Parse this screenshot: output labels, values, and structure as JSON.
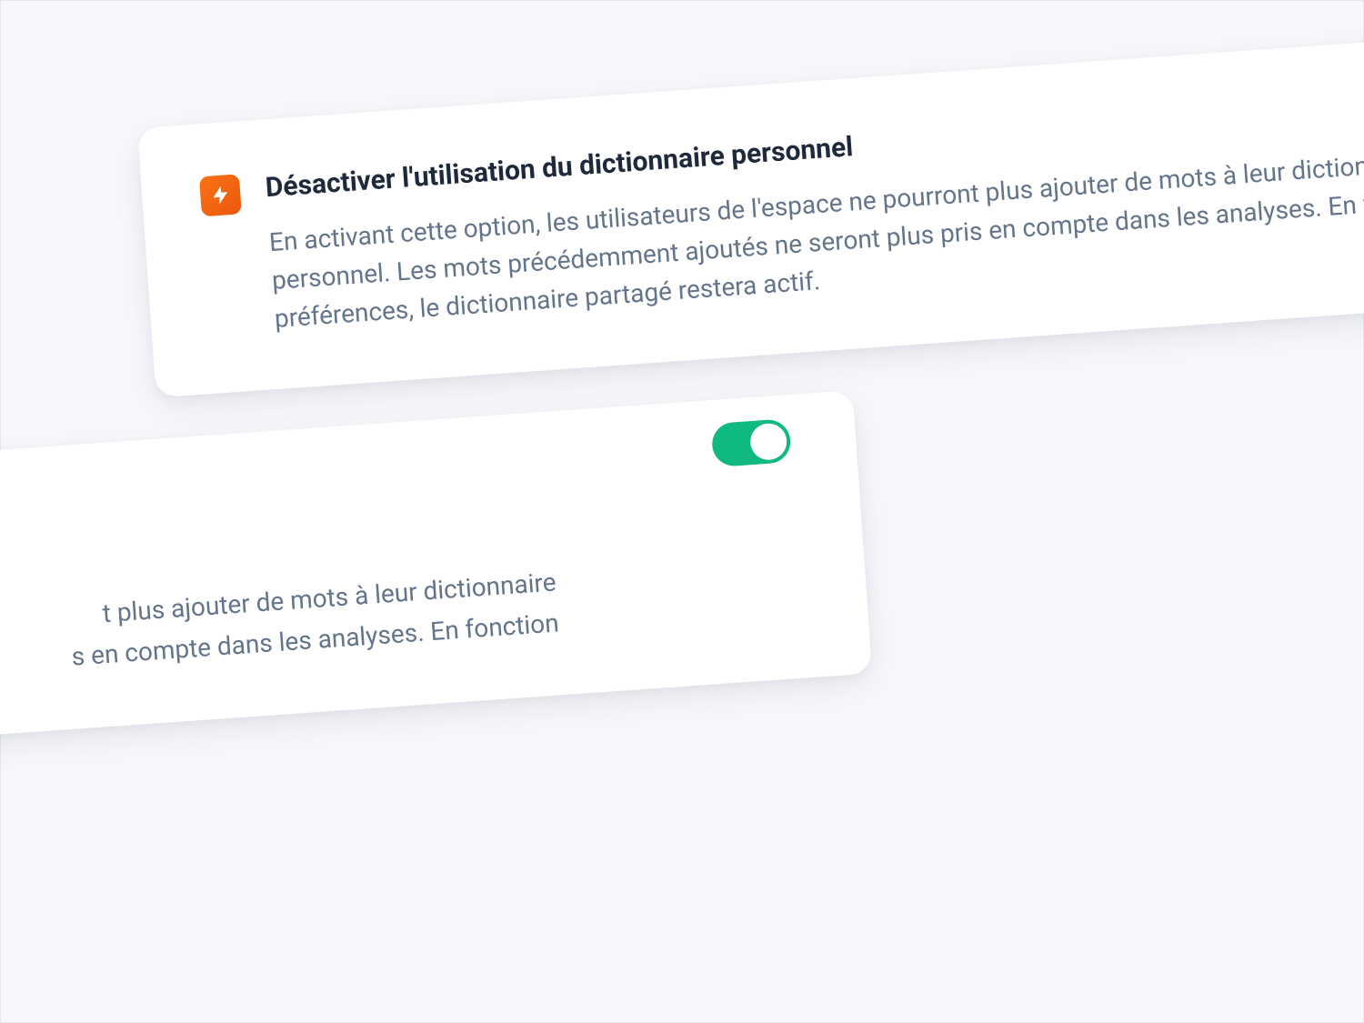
{
  "cards": {
    "top": {
      "title": "Désactiver l'utilisation du dictionnaire personnel",
      "description": "En activant cette option, les utilisateurs de l'espace ne pourront plus ajouter de mots à leur dictionnaire personnel. Les mots précédemment ajoutés ne seront plus pris en compte dans les analyses. En fonction de vos préférences, le dictionnaire partagé restera actif.",
      "icon": "lightning"
    },
    "bottom": {
      "fragment_line1": "t plus ajouter de mots à leur dictionnaire",
      "fragment_line2": "s en compte dans les analyses. En fonction",
      "toggle_on": true
    }
  },
  "colors": {
    "accent_orange": "#f97316",
    "toggle_green": "#10b981",
    "text_dark": "#1e293b",
    "text_muted": "#64748b",
    "bg": "#f7f8fc"
  }
}
